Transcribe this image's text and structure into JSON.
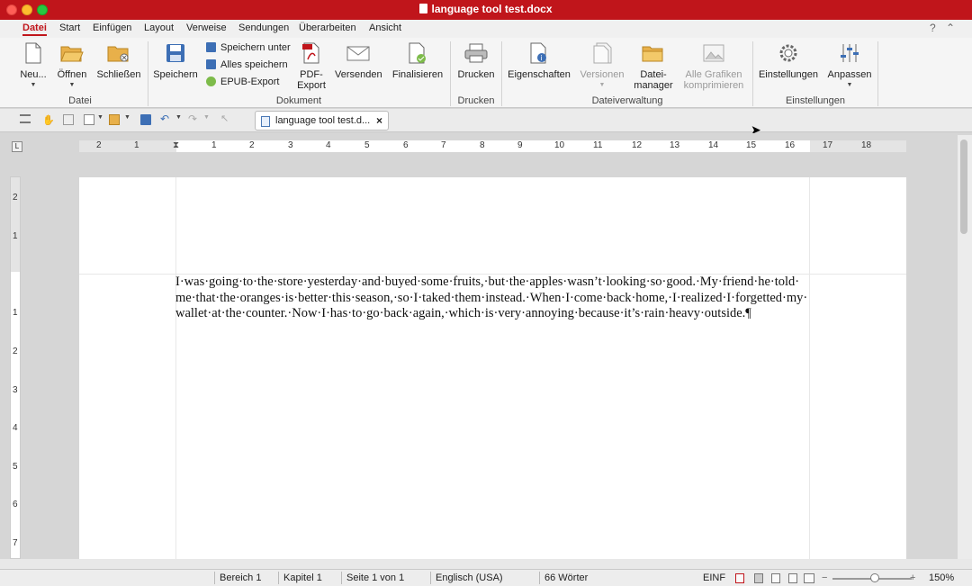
{
  "window": {
    "title": "language tool test.docx"
  },
  "menu": {
    "tabs": [
      "Datei",
      "Start",
      "Einfügen",
      "Layout",
      "Verweise",
      "Sendungen",
      "Überarbeiten",
      "Ansicht"
    ],
    "active": "Datei",
    "help": "?",
    "collapse": "⌃"
  },
  "ribbon": {
    "neu": "Neu...",
    "oeffnen": "Öffnen",
    "schliessen": "Schließen",
    "speichern": "Speichern",
    "speichern_unter": "Speichern unter",
    "alles_speichern": "Alles speichern",
    "epub_export": "EPUB-Export",
    "pdf_export": "PDF-\nExport",
    "pdf_export_l1": "PDF-",
    "pdf_export_l2": "Export",
    "versenden": "Versenden",
    "finalisieren": "Finalisieren",
    "drucken": "Drucken",
    "eigenschaften": "Eigenschaften",
    "versionen": "Versionen",
    "dateimanager_l1": "Datei-",
    "dateimanager_l2": "manager",
    "alle_grafiken_l1": "Alle Grafiken",
    "alle_grafiken_l2": "komprimieren",
    "einstellungen": "Einstellungen",
    "anpassen": "Anpassen",
    "groups": {
      "datei": "Datei",
      "dokument": "Dokument",
      "drucken": "Drucken",
      "dateiverwaltung": "Dateiverwaltung",
      "einstellungen": "Einstellungen"
    }
  },
  "doc_tab": {
    "label": "language tool test.d...",
    "close": "×"
  },
  "ruler": {
    "numbers": [
      "2",
      "1",
      "1",
      "2",
      "3",
      "4",
      "5",
      "6",
      "7",
      "8",
      "9",
      "10",
      "11",
      "12",
      "13",
      "14",
      "15",
      "16",
      "17",
      "18"
    ],
    "corner": "L"
  },
  "vruler": {
    "numbers": [
      "2",
      "1",
      "1",
      "2",
      "3",
      "4",
      "5",
      "6",
      "7"
    ]
  },
  "document": {
    "line1": "I·was·going·to·the·store·yesterday·and·buyed·some·fruits,·but·the·apples·wasn’t·looking·so·good.·My·friend·he·told·",
    "line2": "me·that·the·oranges·is·better·this·season,·so·I·taked·them·instead.·When·I·come·back·home,·I·realized·I·forgetted·my·",
    "line3": "wallet·at·the·counter.·Now·I·has·to·go·back·again,·which·is·very·annoying·because·it’s·rain·heavy·outside.¶"
  },
  "status": {
    "bereich": "Bereich 1",
    "kapitel": "Kapitel 1",
    "seite": "Seite 1 von 1",
    "sprache": "Englisch (USA)",
    "woerter": "66 Wörter",
    "modus": "EINF",
    "zoom": "150%",
    "zoom_minus": "−",
    "zoom_plus": "+"
  },
  "colors": {
    "accent": "#c0151b",
    "titlebar": "#c0151b"
  }
}
